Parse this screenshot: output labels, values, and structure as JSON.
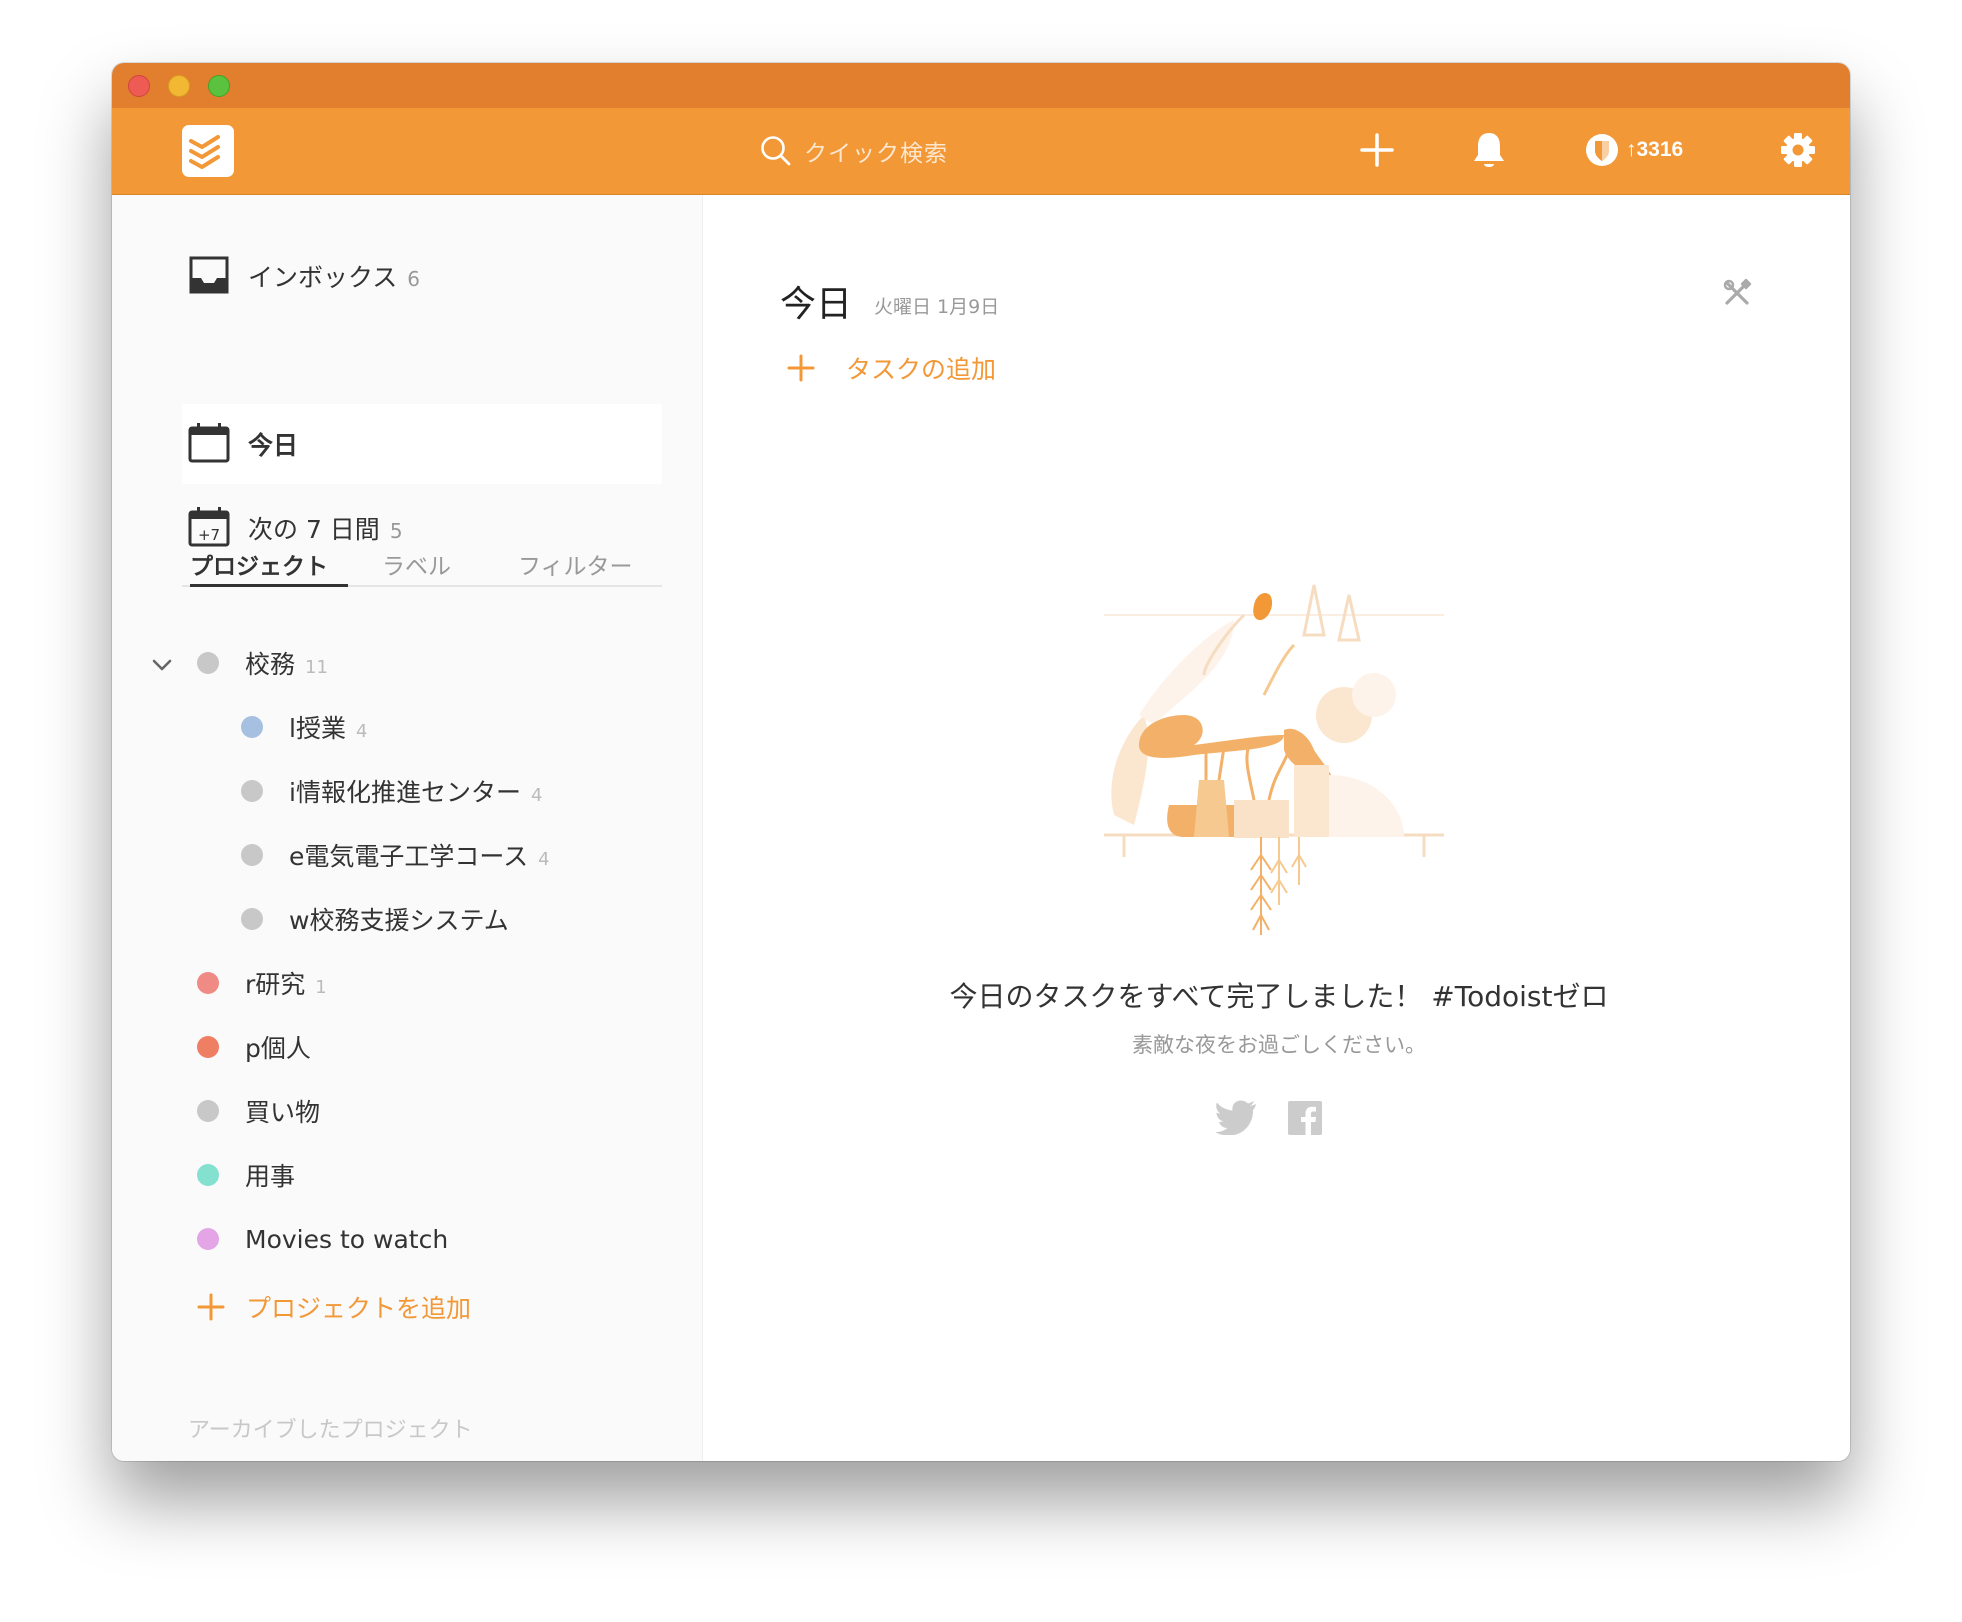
{
  "header": {
    "search_placeholder": "クイック検索",
    "karma_score": "↑3316"
  },
  "sidebar": {
    "nav": [
      {
        "label": "インボックス",
        "count": "6"
      },
      {
        "label": "今日",
        "count": ""
      },
      {
        "label": "次の 7 日間",
        "count": "5"
      }
    ],
    "next7_badge": "+7",
    "tabs": [
      "プロジェクト",
      "ラベル",
      "フィルター"
    ],
    "projects": [
      {
        "label": "校務",
        "count": "11",
        "color": "#c8c8c8"
      },
      {
        "label": "l授業",
        "count": "4",
        "color": "#a5c0e0"
      },
      {
        "label": "i情報化推進センター",
        "count": "4",
        "color": "#c8c8c8"
      },
      {
        "label": "e電気電子工学コース",
        "count": "4",
        "color": "#c8c8c8"
      },
      {
        "label": "w校務支援システム",
        "count": "",
        "color": "#c8c8c8"
      },
      {
        "label": "r研究",
        "count": "1",
        "color": "#ef8a84"
      },
      {
        "label": "p個人",
        "count": "",
        "color": "#ee7f63"
      },
      {
        "label": "買い物",
        "count": "",
        "color": "#c8c8c8"
      },
      {
        "label": "用事",
        "count": "",
        "color": "#84e0cf"
      },
      {
        "label": "Movies to watch",
        "count": "",
        "color": "#e3a5e6"
      }
    ],
    "add_project": "プロジェクトを追加",
    "archived": "アーカイブしたプロジェクト"
  },
  "main": {
    "title": "今日",
    "date": "火曜日 1月9日",
    "add_task": "タスクの追加",
    "empty_title": "今日のタスクをすべて完了しました！ #Todoistゼロ",
    "empty_sub": "素敵な夜をお過ごしください。"
  },
  "colors": {
    "accent": "#f29837",
    "titlebar": "#e17f2f"
  }
}
